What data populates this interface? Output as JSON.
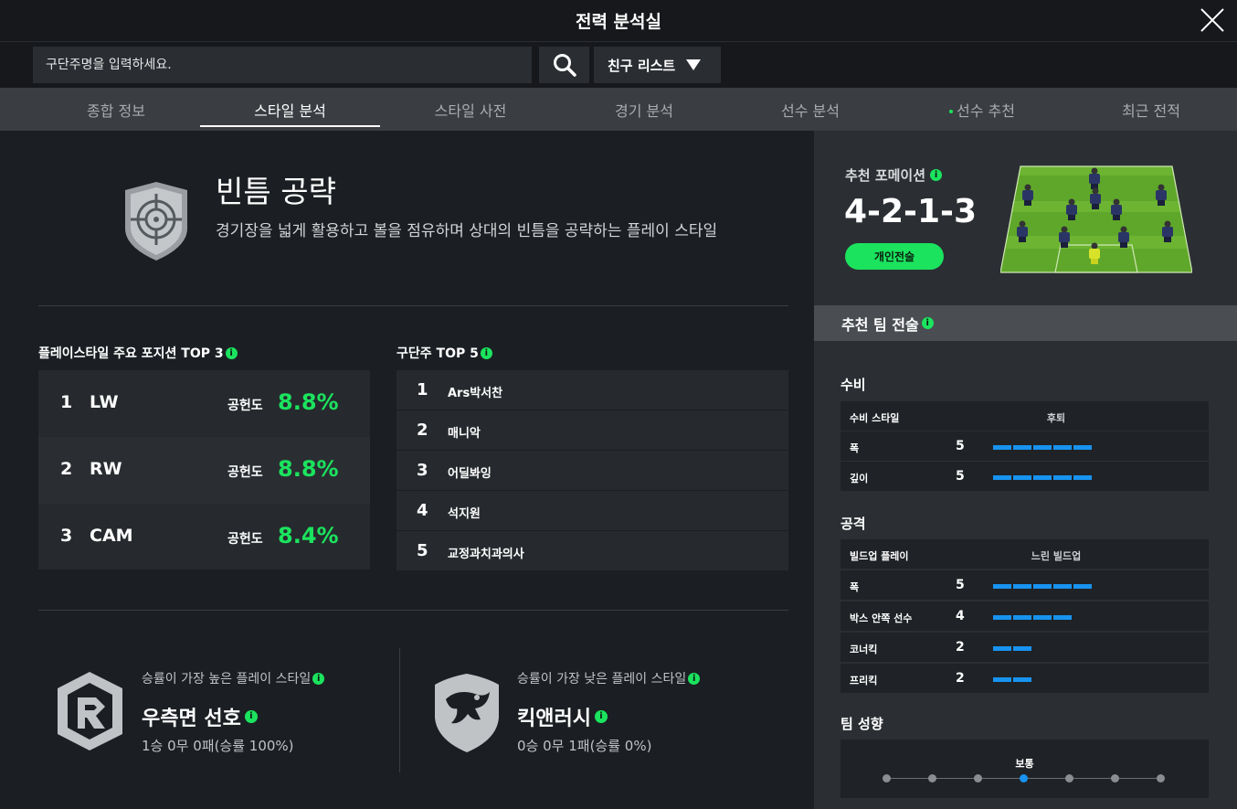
{
  "title": "전력 분석실",
  "search": {
    "placeholder": "구단주명을 입력하세요."
  },
  "friend_list_label": "친구 리스트",
  "tabs": [
    "종합 정보",
    "스타일 분석",
    "스타일 사전",
    "경기 분석",
    "선수 분석",
    "선수 추천",
    "최근 전적"
  ],
  "active_tab": "스타일 분석",
  "style": {
    "name": "빈틈 공략",
    "description": "경기장을 넓게 활용하고 볼을 점유하며 상대의 빈틈을 공략하는 플레이 스타일"
  },
  "positions_top": {
    "title": "플레이스타일 주요 포지션 TOP 3",
    "contrib_label": "공헌도",
    "rows": [
      {
        "rank": "1",
        "pos": "LW",
        "pct": "8.8%"
      },
      {
        "rank": "2",
        "pos": "RW",
        "pct": "8.8%"
      },
      {
        "rank": "3",
        "pos": "CAM",
        "pct": "8.4%"
      }
    ]
  },
  "managers_top": {
    "title": "구단주 TOP 5",
    "rows": [
      {
        "rank": "1",
        "name": "Ars박서찬"
      },
      {
        "rank": "2",
        "name": "매니악"
      },
      {
        "rank": "3",
        "name": "어딜봐잉"
      },
      {
        "rank": "4",
        "name": "석지원"
      },
      {
        "rank": "5",
        "name": "교정과치과의사"
      }
    ]
  },
  "best_style": {
    "label": "승률이 가장 높은 플레이 스타일",
    "name": "우측면 선호",
    "record": "1승 0무 0패(승률 100%)"
  },
  "worst_style": {
    "label": "승률이 가장 낮은 플레이 스타일",
    "name": "킥앤러시",
    "record": "0승 0무 1패(승률 0%)"
  },
  "recommend": {
    "formation_label": "추천 포메이션",
    "formation": "4-2-1-3",
    "tactic_button": "개인전술",
    "team_tactic_label": "추천 팀 전술",
    "defense": {
      "title": "수비",
      "style_key": "수비 스타일",
      "style_value": "후퇴",
      "rows": [
        {
          "key": "폭",
          "value": 5
        },
        {
          "key": "깊이",
          "value": 5
        }
      ]
    },
    "attack": {
      "title": "공격",
      "style_key": "빌드업 플레이",
      "style_value": "느린 빌드업",
      "rows": [
        {
          "key": "폭",
          "value": 5
        },
        {
          "key": "박스 안쪽 선수",
          "value": 4
        },
        {
          "key": "코너킥",
          "value": 2
        },
        {
          "key": "프리킥",
          "value": 2
        }
      ]
    },
    "tendency": {
      "title": "팀 성향",
      "label": "보통",
      "level": 4,
      "max": 7
    }
  },
  "colors": {
    "accent_green": "#1be35e",
    "bar_blue": "#1893f0",
    "background": "#1b1f23"
  }
}
